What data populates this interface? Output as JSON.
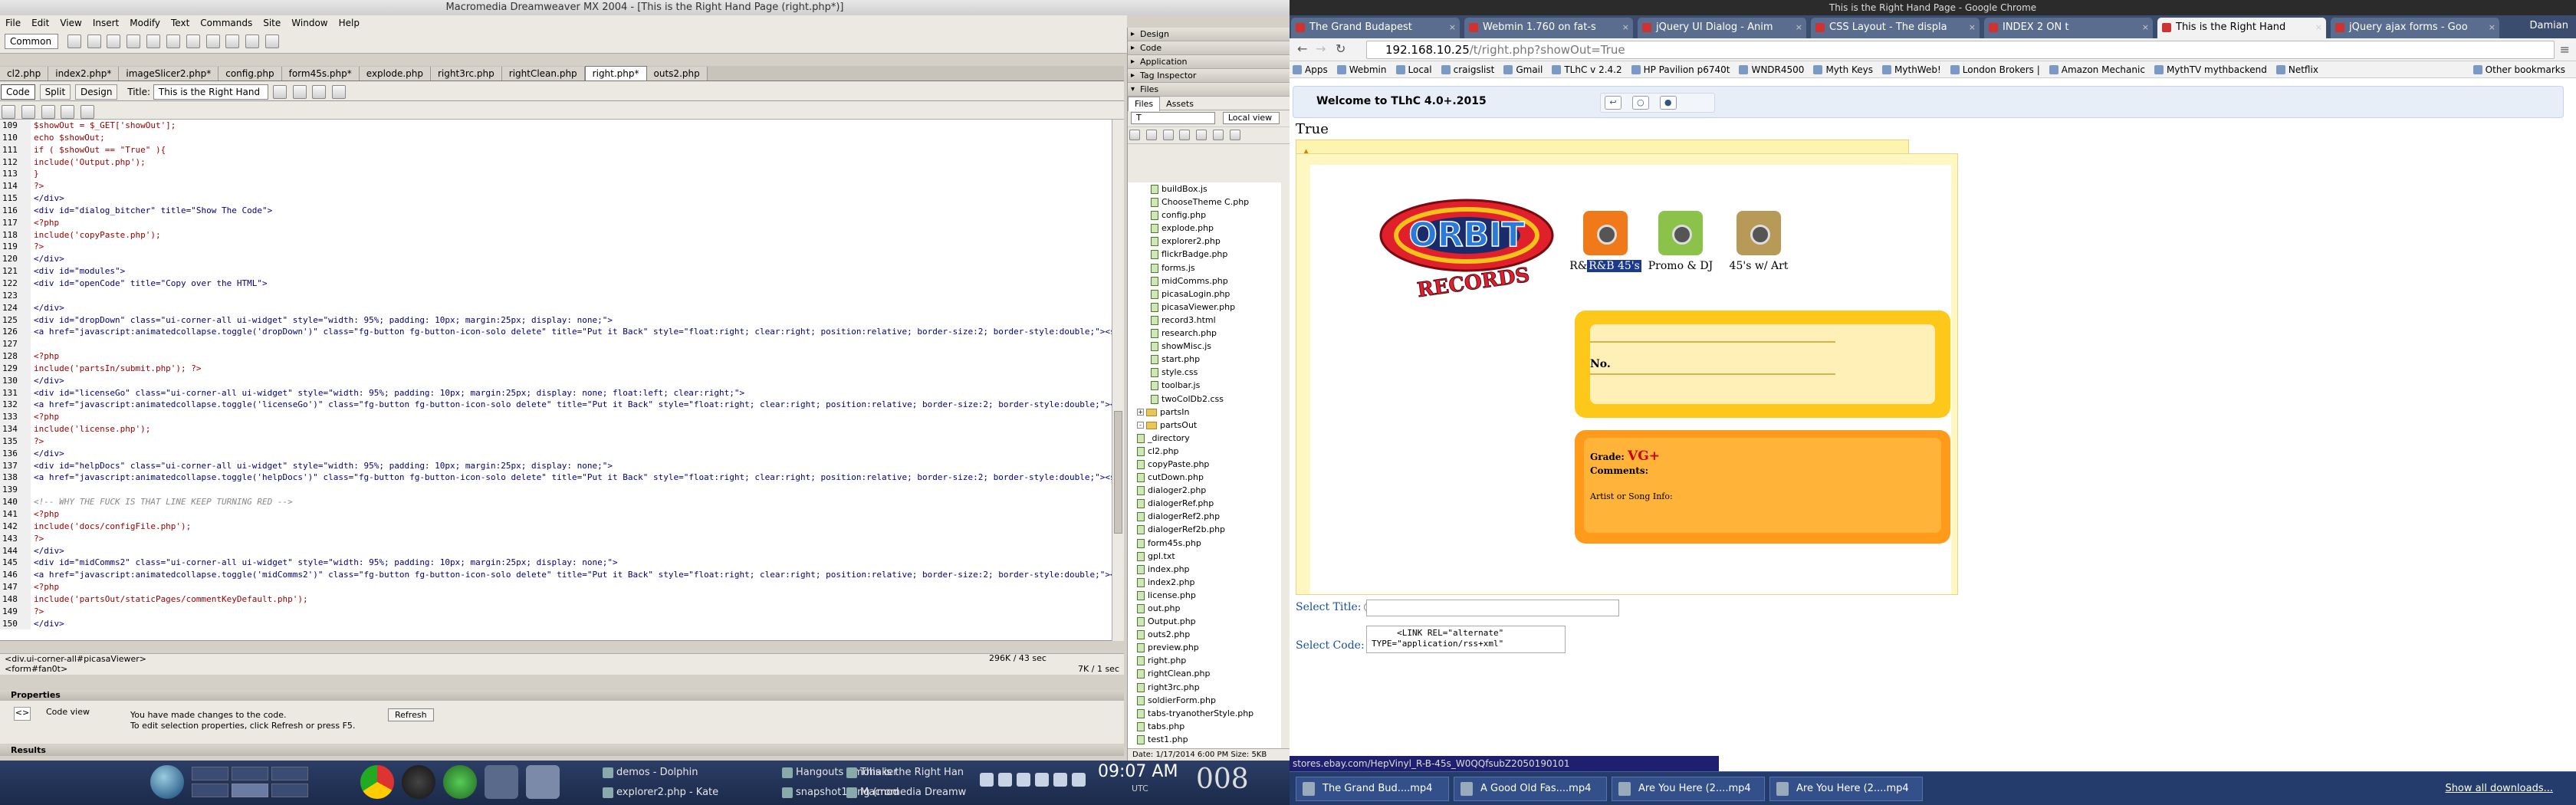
{
  "dreamweaver": {
    "title": "Macromedia Dreamweaver MX 2004 - [This is the Right Hand Page (right.php*)]",
    "menu": [
      "File",
      "Edit",
      "View",
      "Insert",
      "Modify",
      "Text",
      "Commands",
      "Site",
      "Window",
      "Help"
    ],
    "insert_category": "Common",
    "doc_tabs": [
      "cl2.php",
      "index2.php*",
      "imageSlicer2.php*",
      "config.php",
      "form45s.php*",
      "explode.php",
      "right3rc.php",
      "rightClean.php",
      "right.php*",
      "outs2.php"
    ],
    "active_tab_index": 8,
    "view_buttons": {
      "code": "Code",
      "split": "Split",
      "design": "Design"
    },
    "title_label": "Title:",
    "title_value": "This is the Right Hand Page",
    "code_lines": [
      {
        "n": "109",
        "t": "        $showOut = $_GET['showOut'];"
      },
      {
        "n": "110",
        "t": "        echo $showOut;"
      },
      {
        "n": "111",
        "t": "        if ( $showOut == \"True\" ){"
      },
      {
        "n": "112",
        "t": "            include('Output.php');"
      },
      {
        "n": "113",
        "t": "        }"
      },
      {
        "n": "114",
        "t": "    ?>"
      },
      {
        "n": "115",
        "t": "</div>"
      },
      {
        "n": "116",
        "t": "<div id=\"dialog_bitcher\" title=\"Show The Code\">"
      },
      {
        "n": "117",
        "t": "  <?php"
      },
      {
        "n": "118",
        "t": "include('copyPaste.php');"
      },
      {
        "n": "119",
        "t": "  ?>"
      },
      {
        "n": "120",
        "t": "</div>"
      },
      {
        "n": "121",
        "t": "<div id=\"modules\">"
      },
      {
        "n": "122",
        "t": "<div id=\"openCode\" title=\"Copy over the HTML\">"
      },
      {
        "n": "123",
        "t": ""
      },
      {
        "n": "124",
        "t": "</div>"
      },
      {
        "n": "125",
        "t": "<div id=\"dropDown\" class=\"ui-corner-all ui-widget\" style=\"width: 95%; padding: 10px; margin:25px; display: none;\">"
      },
      {
        "n": "126",
        "t": "<a href=\"javascript:animatedcollapse.toggle('dropDown')\" class=\"fg-button fg-button-icon-solo delete\" title=\"Put it Back\" style=\"float:right; clear:right; position:relative; border-size:2; border-style:double;\"><span class=\"ui-icon ui-icon-arrowthickstop-1-n\"></span></a>"
      },
      {
        "n": "127",
        "t": ""
      },
      {
        "n": "128",
        "t": "  <?php"
      },
      {
        "n": "129",
        "t": "  include('partsIn/submit.php'); ?>"
      },
      {
        "n": "130",
        "t": "</div>"
      },
      {
        "n": "131",
        "t": "<div id=\"licenseGo\" class=\"ui-corner-all ui-widget\" style=\"width: 95%; padding: 10px; margin:25px; display: none; float:left; clear:right;\">"
      },
      {
        "n": "132",
        "t": "<a href=\"javascript:animatedcollapse.toggle('licenseGo')\" class=\"fg-button fg-button-icon-solo delete\" title=\"Put it Back\" style=\"float:right; clear:right; position:relative; border-size:2; border-style:double;\"><span class=\"ui-icon ui-icon-arrowthickstop-1-n\"></span></a>"
      },
      {
        "n": "133",
        "t": "    <?php"
      },
      {
        "n": "134",
        "t": "    include('license.php');"
      },
      {
        "n": "135",
        "t": "    ?>"
      },
      {
        "n": "136",
        "t": "</div>"
      },
      {
        "n": "137",
        "t": "<div id=\"helpDocs\" class=\"ui-corner-all ui-widget\" style=\"width: 95%; padding: 10px; margin:25px; display: none;\">"
      },
      {
        "n": "138",
        "t": "<a href=\"javascript:animatedcollapse.toggle('helpDocs')\" class=\"fg-button fg-button-icon-solo delete\" title=\"Put it Back\" style=\"float:right; clear:right; position:relative; border-size:2; border-style:double;\"><span class=\"ui-icon ui-icon-arrowthickstop-1-n\"></span></a>"
      },
      {
        "n": "139",
        "t": ""
      },
      {
        "n": "140",
        "t": "<!-- WHY THE FUCK IS THAT LINE KEEP TURNING RED -->"
      },
      {
        "n": "141",
        "t": "  <?php"
      },
      {
        "n": "142",
        "t": "    include('docs/configFile.php');"
      },
      {
        "n": "143",
        "t": "    ?>"
      },
      {
        "n": "144",
        "t": "</div>"
      },
      {
        "n": "145",
        "t": "<div id=\"midComms2\" class=\"ui-corner-all ui-widget\" style=\"width: 95%; padding: 10px; margin:25px; display: none;\">"
      },
      {
        "n": "146",
        "t": "<a href=\"javascript:animatedcollapse.toggle('midComms2')\" class=\"fg-button fg-button-icon-solo delete\" title=\"Put it Back\" style=\"float:right; clear:right; position:relative; border-size:2; border-style:double;\"><span class=\"ui-icon ui-icon-arrowthickstop-1-n\"></span></a>"
      },
      {
        "n": "147",
        "t": "    <?php"
      },
      {
        "n": "148",
        "t": "    include('partsOut/staticPages/commentKeyDefault.php');"
      },
      {
        "n": "149",
        "t": "    ?>"
      },
      {
        "n": "150",
        "t": "</div>"
      }
    ],
    "tag_selector": "<div.ui-corner-all#picasaViewer>",
    "tag_selector2": "<form#fan0t>",
    "status_size": "296K / 43 sec",
    "status_size2": "7K / 1 sec",
    "properties_label": "Properties",
    "code_view_label": "Code view",
    "props_message_1": "You have made changes to the code.",
    "props_message_2": "To edit selection properties, click Refresh or press F5.",
    "refresh_button": "Refresh",
    "results_label": "Results",
    "panel_groups": [
      "Design",
      "Code",
      "Application",
      "Tag Inspector"
    ],
    "files_panel_label": "Files",
    "files_tabs": [
      "Files",
      "Assets"
    ],
    "site_select": "T",
    "view_select": "Local view",
    "file_tree": [
      {
        "name": "buildBox.js",
        "type": "file",
        "indent": 2
      },
      {
        "name": "ChooseTheme C.php",
        "type": "file",
        "indent": 2
      },
      {
        "name": "config.php",
        "type": "file",
        "indent": 2
      },
      {
        "name": "explode.php",
        "type": "file",
        "indent": 2
      },
      {
        "name": "explorer2.php",
        "type": "file",
        "indent": 2
      },
      {
        "name": "flickrBadge.php",
        "type": "file",
        "indent": 2
      },
      {
        "name": "forms.js",
        "type": "file",
        "indent": 2
      },
      {
        "name": "midComms.php",
        "type": "file",
        "indent": 2
      },
      {
        "name": "picasaLogin.php",
        "type": "file",
        "indent": 2
      },
      {
        "name": "picasaViewer.php",
        "type": "file",
        "indent": 2
      },
      {
        "name": "record3.html",
        "type": "file",
        "indent": 2
      },
      {
        "name": "research.php",
        "type": "file",
        "indent": 2
      },
      {
        "name": "showMisc.js",
        "type": "file",
        "indent": 2
      },
      {
        "name": "start.php",
        "type": "file",
        "indent": 2
      },
      {
        "name": "style.css",
        "type": "file",
        "indent": 2
      },
      {
        "name": "toolbar.js",
        "type": "file",
        "indent": 2
      },
      {
        "name": "twoColDb2.css",
        "type": "file",
        "indent": 2
      },
      {
        "name": "partsIn",
        "type": "folder",
        "indent": 1,
        "exp": "+"
      },
      {
        "name": "partsOut",
        "type": "folder",
        "indent": 1,
        "exp": "-"
      },
      {
        "name": "_directory",
        "type": "file",
        "indent": 1
      },
      {
        "name": "cl2.php",
        "type": "file",
        "indent": 1
      },
      {
        "name": "copyPaste.php",
        "type": "file",
        "indent": 1
      },
      {
        "name": "cutDown.php",
        "type": "file",
        "indent": 1
      },
      {
        "name": "dialoger2.php",
        "type": "file",
        "indent": 1
      },
      {
        "name": "dialogerRef.php",
        "type": "file",
        "indent": 1
      },
      {
        "name": "dialogerRef2.php",
        "type": "file",
        "indent": 1
      },
      {
        "name": "dialogerRef2b.php",
        "type": "file",
        "indent": 1
      },
      {
        "name": "form45s.php",
        "type": "file",
        "indent": 1
      },
      {
        "name": "gpl.txt",
        "type": "file",
        "indent": 1
      },
      {
        "name": "index.php",
        "type": "file",
        "indent": 1
      },
      {
        "name": "index2.php",
        "type": "file",
        "indent": 1
      },
      {
        "name": "license.php",
        "type": "file",
        "indent": 1
      },
      {
        "name": "out.php",
        "type": "file",
        "indent": 1
      },
      {
        "name": "Output.php",
        "type": "file",
        "indent": 1
      },
      {
        "name": "outs2.php",
        "type": "file",
        "indent": 1
      },
      {
        "name": "preview.php",
        "type": "file",
        "indent": 1
      },
      {
        "name": "right.php",
        "type": "file",
        "indent": 1
      },
      {
        "name": "rightClean.php",
        "type": "file",
        "indent": 1
      },
      {
        "name": "right3rc.php",
        "type": "file",
        "indent": 1
      },
      {
        "name": "soldierForm.php",
        "type": "file",
        "indent": 1
      },
      {
        "name": "tabs-tryanotherStyle.php",
        "type": "file",
        "indent": 1
      },
      {
        "name": "tabs.php",
        "type": "file",
        "indent": 1
      },
      {
        "name": "test1.php",
        "type": "file",
        "indent": 1
      }
    ],
    "files_date": "Date: 1/17/2014 6:00 PM  Size: 5KB"
  },
  "chrome": {
    "window_title": "This is the Right Hand Page - Google Chrome",
    "tabs": [
      "The Grand Budapest",
      "Webmin 1.760 on fat-s",
      "jQuery UI Dialog - Anim",
      "CSS Layout - The displa",
      "INDEX 2 ON t",
      "This is the Right Hand",
      "jQuery ajax forms - Goo"
    ],
    "active_tab_index": 5,
    "user": "Damian",
    "url_host": "192.168.10.25",
    "url_path": "/t/right.php?showOut=True",
    "bookmarks": [
      "Apps",
      "Webmin",
      "Local",
      "craigslist",
      "Gmail",
      "TLhC v 2.4.2",
      "HP Pavilion p6740t",
      "WNDR4500",
      "Myth Keys",
      "MythWeb!",
      "London Brokers |",
      "Amazon Mechanic",
      "MythTV mythbackend",
      "Netflix",
      "Other bookmarks"
    ],
    "page": {
      "welcome": "Welcome to TLhC 4.0+.2015",
      "toolbar_icons": [
        "↩",
        "○",
        "●"
      ],
      "true_text": "True",
      "categories": [
        {
          "label_pre": "R&",
          "label_hl": "R&B 45's",
          "label_post": "",
          "color": "#f07a1a"
        },
        {
          "label_pre": "",
          "label_hl": "",
          "label_post": "Promo & DJ",
          "color": "#8bc34a"
        },
        {
          "label_pre": "",
          "label_hl": "",
          "label_post": "45's w/ Art",
          "color": "#b89a58"
        }
      ],
      "logo_word": "ORBIT",
      "logo_word2": "RECORDS",
      "no_label": "No.",
      "grade_label": "Grade:",
      "grade_value": "VG+",
      "comments_label": "Comments:",
      "artist_label": "Artist or Song Info:",
      "select_title_label": "Select Title:",
      "select_code_label": "Select Code:",
      "code_value": "     <LINK REL=\"alternate\"\nTYPE=\"application/rss+xml\""
    },
    "hover_url": "stores.ebay.com/HepVinyl_R-B-45s_W0QQfsubZ2050190101",
    "downloads": [
      "The Grand Bud....mp4",
      "A Good Old Fas....mp4",
      "Are You Here (2....mp4",
      "Are You Here (2....mp4"
    ],
    "show_all_downloads": "Show all downloads..."
  },
  "taskbar": {
    "windows": [
      "demos - Dolphin",
      "explorer2.php - Kate",
      "Hangouts - mohaker",
      "snapshot1.png (mod",
      "This is the Right Han",
      "Macromedia Dreamw"
    ],
    "clock": "09:07 AM",
    "timezone": "UTC",
    "partial_text": "008"
  }
}
